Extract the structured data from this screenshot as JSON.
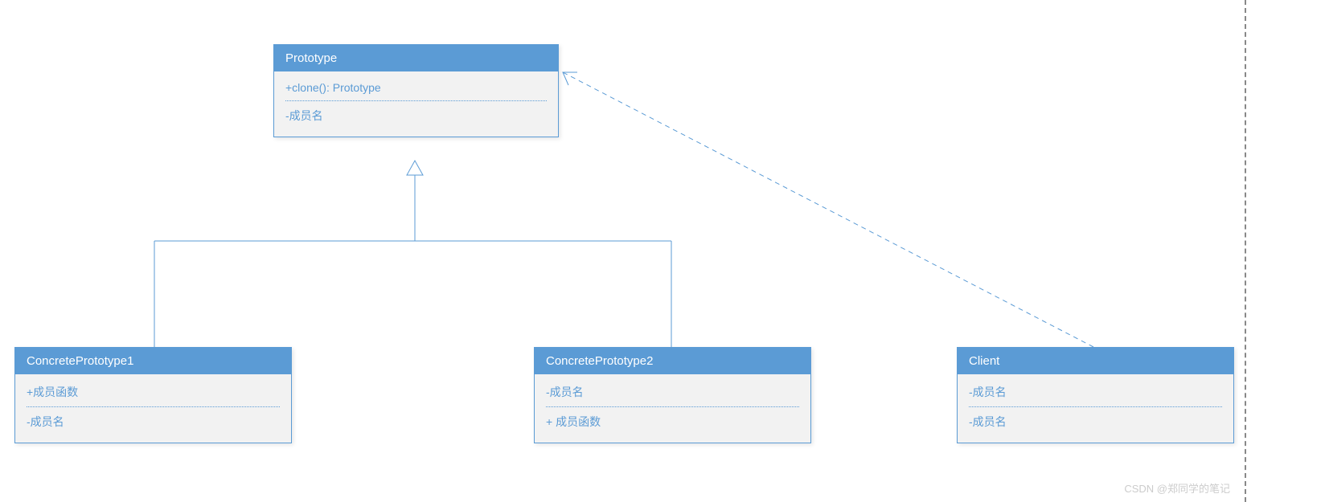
{
  "classes": {
    "prototype": {
      "title": "Prototype",
      "member1": "+clone(): Prototype",
      "member2": "-成员名"
    },
    "concrete1": {
      "title": "ConcretePrototype1",
      "member1": "+成员函数",
      "member2": "-成员名"
    },
    "concrete2": {
      "title": "ConcretePrototype2",
      "member1": "-成员名",
      "member2": "+ 成员函数"
    },
    "client": {
      "title": "Client",
      "member1": "-成员名",
      "member2": "-成员名"
    }
  },
  "watermark": "CSDN @郑同学的笔记"
}
